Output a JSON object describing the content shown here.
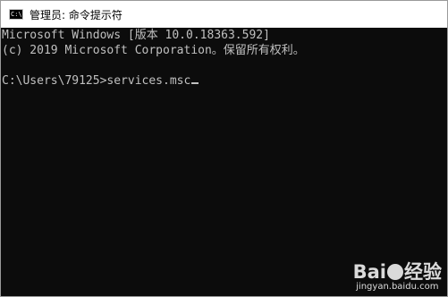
{
  "window": {
    "title": "管理员: 命令提示符",
    "icon_label": "C:\\."
  },
  "console": {
    "lines": [
      "Microsoft Windows [版本 10.0.18363.592]",
      "(c) 2019 Microsoft Corporation。保留所有权利。",
      "",
      "C:\\Users\\79125>services.msc"
    ]
  },
  "watermark": {
    "logo_left": "Bai",
    "logo_right": "经验",
    "url": "jingyan.baidu.com"
  }
}
